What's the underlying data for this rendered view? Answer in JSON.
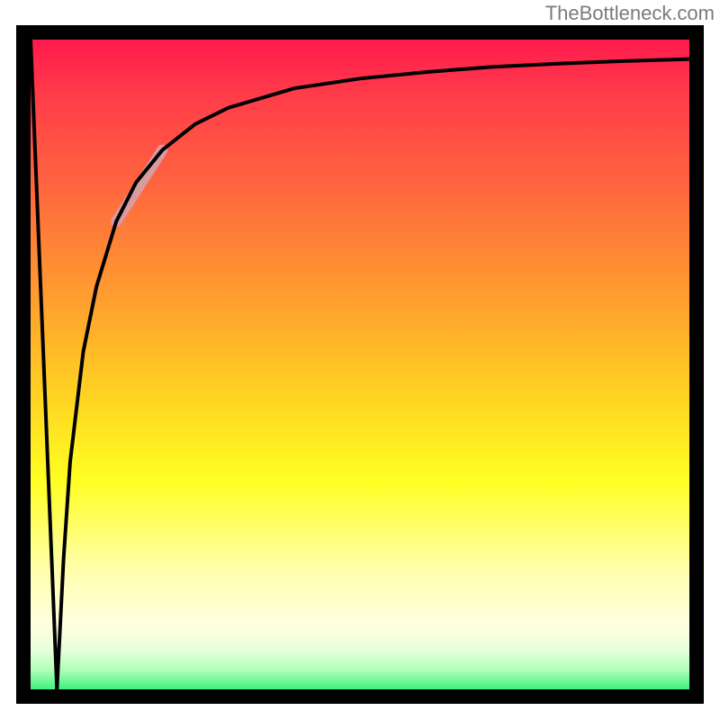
{
  "watermark": "TheBottleneck.com",
  "chart_data": {
    "type": "line",
    "title": "",
    "xlabel": "",
    "ylabel": "",
    "xlim": [
      0,
      100
    ],
    "ylim": [
      0,
      100
    ],
    "grid": false,
    "legend": false,
    "background_gradient": {
      "top": "#ff1a4d",
      "mid": "#ffff22",
      "bottom": "#3ff27d"
    },
    "series": [
      {
        "name": "left-drop",
        "stroke": "#000000",
        "stroke_width": 4,
        "x": [
          0.0,
          2.0,
          4.0
        ],
        "y": [
          100.0,
          50.0,
          0.0
        ]
      },
      {
        "name": "main-curve",
        "stroke": "#000000",
        "stroke_width": 4,
        "x": [
          4.0,
          5.0,
          6.0,
          8.0,
          10.0,
          13.0,
          16.0,
          20.0,
          25.0,
          30.0,
          40.0,
          50.0,
          60.0,
          70.0,
          80.0,
          90.0,
          100.0
        ],
        "y": [
          0.0,
          20.0,
          35.0,
          52.0,
          62.0,
          72.0,
          78.0,
          83.0,
          87.0,
          89.5,
          92.5,
          94.0,
          95.0,
          95.8,
          96.3,
          96.7,
          97.0
        ]
      },
      {
        "name": "highlight-segment",
        "stroke": "#d99aa0",
        "stroke_width": 12,
        "x": [
          13.0,
          20.0
        ],
        "y": [
          72.0,
          83.0
        ]
      }
    ]
  }
}
